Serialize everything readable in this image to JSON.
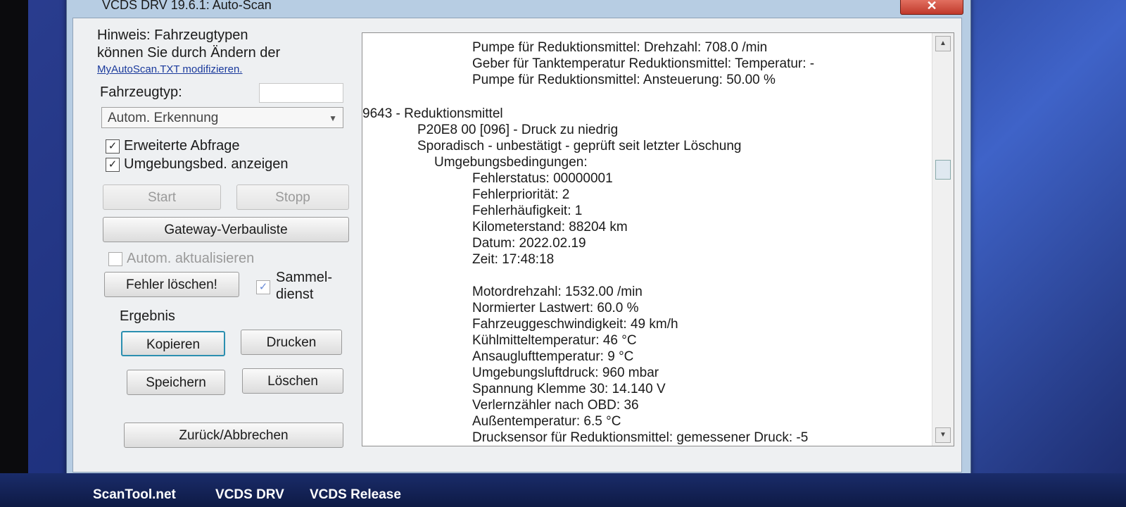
{
  "window": {
    "title": "VCDS DRV 19.6.1: Auto-Scan",
    "close_label": "✕"
  },
  "left_panel": {
    "hint_line1": "Hinweis: Fahrzeugtypen",
    "hint_line2": "können Sie durch Ändern der",
    "hint_link": "MyAutoScan.TXT modifizieren.",
    "vehicle_type_label": "Fahrzeugtyp:",
    "vehicle_type_value": "Autom. Erkennung",
    "ext_query_label": "Erweiterte Abfrage",
    "env_cond_label": "Umgebungsbed. anzeigen",
    "start_label": "Start",
    "stop_label": "Stopp",
    "gateway_label": "Gateway-Verbauliste",
    "auto_update_label": "Autom. aktualisieren",
    "clear_faults_label": "Fehler löschen!",
    "group_line1": "Sammel-",
    "group_line2": "dienst",
    "result_label": "Ergebnis",
    "copy_label": "Kopieren",
    "print_label": "Drucken",
    "save_label": "Speichern",
    "delete_label": "Löschen",
    "back_label": "Zurück/Abbrechen"
  },
  "results": {
    "lines": [
      "Pumpe für Reduktionsmittel: Drehzahl: 708.0 /min",
      "Geber für Tanktemperatur Reduktionsmittel: Temperatur: -",
      "Pumpe für Reduktionsmittel: Ansteuerung: 50.00 %",
      "9643 - Reduktionsmittel",
      "P20E8 00 [096] - Druck zu niedrig",
      "Sporadisch - unbestätigt - geprüft seit letzter Löschung",
      "Umgebungsbedingungen:",
      "Fehlerstatus: 00000001",
      "Fehlerpriorität: 2",
      "Fehlerhäufigkeit: 1",
      "Kilometerstand: 88204 km",
      "Datum: 2022.02.19",
      "Zeit: 17:48:18",
      "Motordrehzahl: 1532.00 /min",
      "Normierter Lastwert: 60.0 %",
      "Fahrzeuggeschwindigkeit: 49 km/h",
      "Kühlmitteltemperatur: 46 °C",
      "Ansauglufttemperatur: 9 °C",
      "Umgebungsluftdruck: 960 mbar",
      "Spannung Klemme 30: 14.140 V",
      "Verlernzähler nach OBD: 36",
      "Außentemperatur: 6.5 °C",
      "Drucksensor für Reduktionsmittel: gemessener Druck: -5"
    ]
  },
  "taskbar": {
    "items": [
      "ScanTool.net",
      "VCDS DRV",
      "VCDS Release"
    ]
  }
}
